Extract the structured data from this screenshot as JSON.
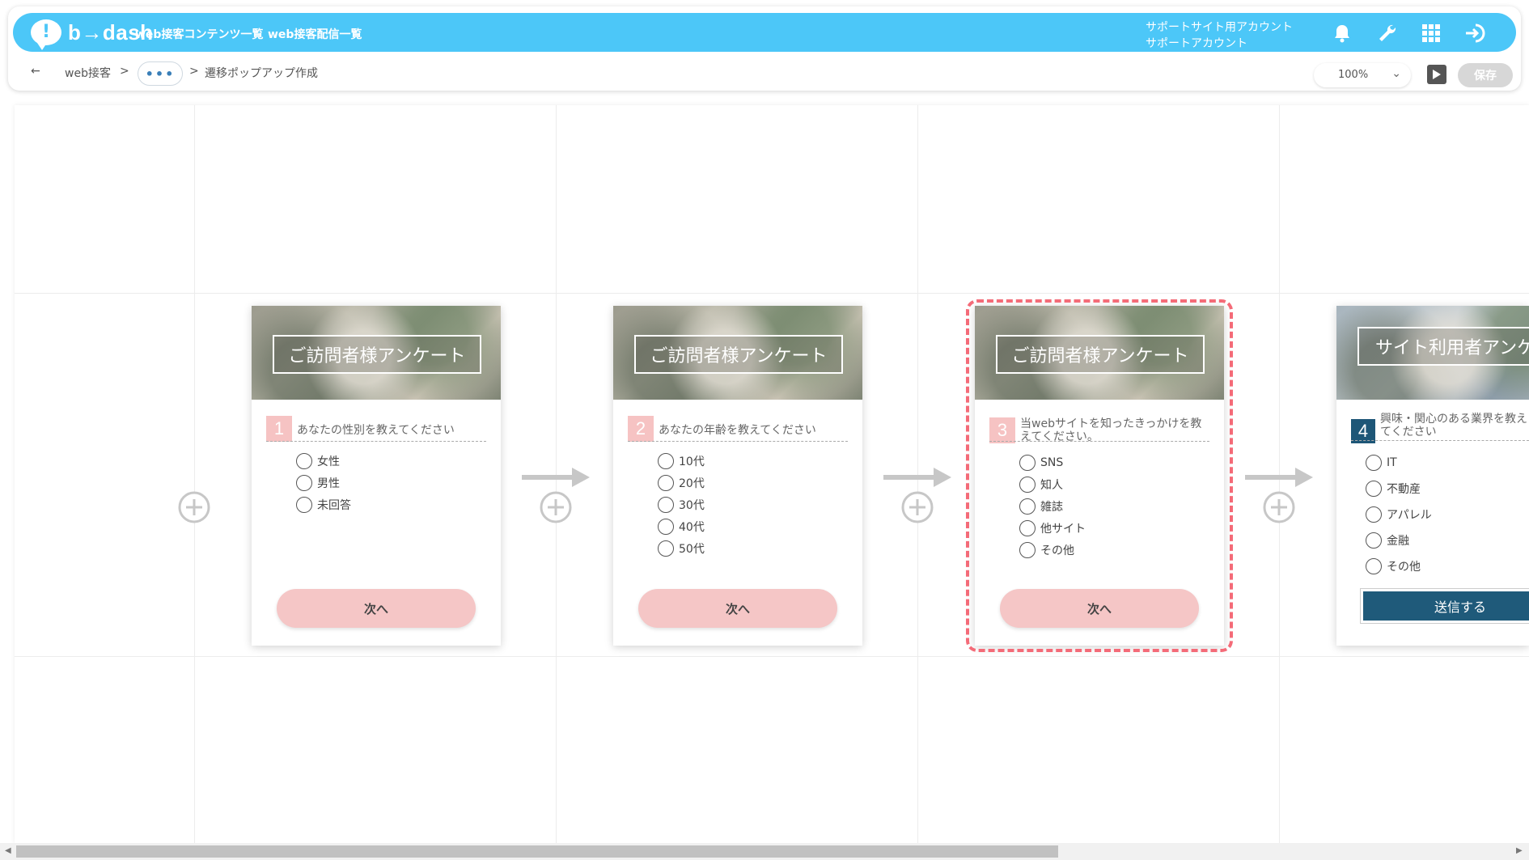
{
  "header": {
    "logo_mark": "!",
    "logo_text": "b→dash",
    "nav": [
      "web接客コンテンツ一覧",
      "web接客配信一覧"
    ],
    "account_line1": "サポートサイト用アカウント",
    "account_line2": "サポートアカウント",
    "icons": [
      "bell-icon",
      "wrench-icon",
      "grid-icon",
      "logout-icon"
    ],
    "accent_color": "#4cc7f8"
  },
  "breadcrumb": {
    "back": "←",
    "root": "web接客",
    "sep1": ">",
    "more": "•••",
    "sep2": ">",
    "current": "遷移ポップアップ作成"
  },
  "toolbar": {
    "zoom": "100%",
    "save_label": "保存"
  },
  "cards": [
    {
      "title": "ご訪問者様アンケート",
      "number": "1",
      "question": "あなたの性別を教えてください",
      "options": [
        "女性",
        "男性",
        "未回答"
      ],
      "button": "次へ"
    },
    {
      "title": "ご訪問者様アンケート",
      "number": "2",
      "question": "あなたの年齢を教えてください",
      "options": [
        "10代",
        "20代",
        "30代",
        "40代",
        "50代"
      ],
      "button": "次へ"
    },
    {
      "title": "ご訪問者様アンケート",
      "number": "3",
      "question": "当webサイトを知ったきっかけを教えてください。",
      "options": [
        "SNS",
        "知人",
        "雑誌",
        "他サイト",
        "その他"
      ],
      "button": "次へ"
    },
    {
      "title": "サイト利用者アンケート",
      "number": "4",
      "question": "興味・関心のある業界を教えてください",
      "options": [
        "IT",
        "不動産",
        "アパレル",
        "金融",
        "その他"
      ],
      "button": "送信する"
    }
  ],
  "colors": {
    "next_button": "#f5c6c6",
    "number_badge": "#f6c3c3",
    "selected_outline": "#f46b78",
    "send_button": "#1f5a7a"
  }
}
